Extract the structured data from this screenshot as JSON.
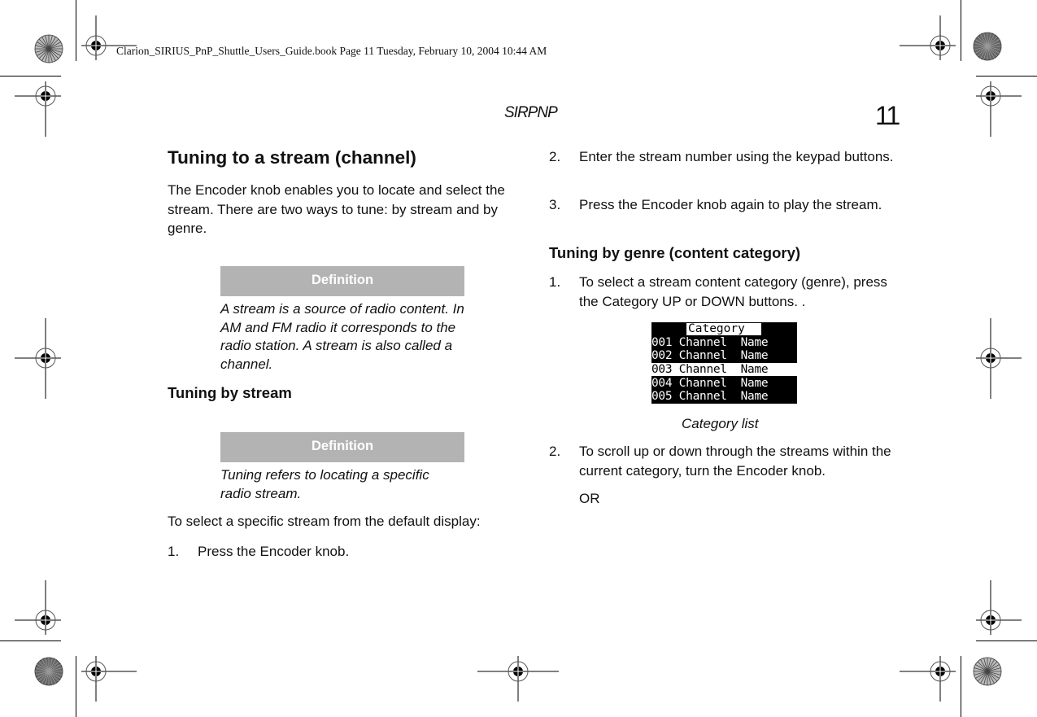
{
  "print_slug": "Clarion_SIRIUS_PnP_Shuttle_Users_Guide.book  Page 11  Tuesday, February 10, 2004  10:44 AM",
  "header": {
    "running_head": "SIRPNP",
    "page_number": "11"
  },
  "left_column": {
    "title": "Tuning to a stream (channel)",
    "intro": "The Encoder knob enables you to locate and select the stream. There are two ways to tune: by stream and by genre.",
    "definition_1": {
      "heading": "Definition",
      "body": "A stream is a source of radio content. In AM and FM radio it corresponds to the radio station. A stream is also called a channel."
    },
    "section_stream": {
      "title": "Tuning by stream"
    },
    "definition_2": {
      "heading": "Definition",
      "body": "Tuning refers to locating a specific radio stream."
    },
    "select_intro": "To select a specific stream from the default display:",
    "steps": [
      {
        "num": "1.",
        "text": "Press the Encoder knob."
      }
    ]
  },
  "right_column": {
    "steps_continued": [
      {
        "num": "2.",
        "text": "Enter the stream number using the keypad buttons."
      },
      {
        "num": "3.",
        "text": "Press the Encoder knob again to play the stream."
      }
    ],
    "section_genre": {
      "title": "Tuning by genre (content category)",
      "steps": [
        {
          "num": "1.",
          "text": "To select a stream content category (genre), press the Category UP or DOWN buttons. ."
        },
        {
          "num": "2.",
          "text": "To scroll up or down through the streams within the current category, turn the Encoder knob."
        }
      ],
      "or_label": "OR"
    },
    "lcd_display": {
      "header": "Category",
      "rows": [
        {
          "text": "001 Channel  Name",
          "selected": false
        },
        {
          "text": "002 Channel  Name",
          "selected": false
        },
        {
          "text": "003 Channel  Name",
          "selected": true
        },
        {
          "text": "004 Channel  Name",
          "selected": false
        },
        {
          "text": "005 Channel  Name",
          "selected": false
        }
      ],
      "caption": "Category list"
    }
  },
  "colors": {
    "definition_header_bg": "#b3b3b3",
    "lcd_bg": "#000000",
    "lcd_fg": "#ffffff"
  }
}
